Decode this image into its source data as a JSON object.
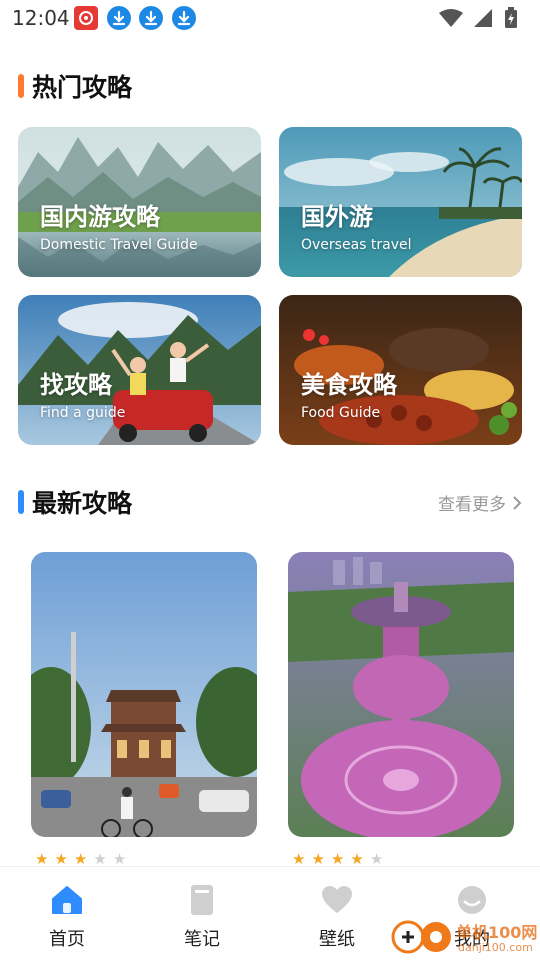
{
  "status_bar": {
    "time": "12:04",
    "notification_icons": [
      "app-red-icon",
      "download-icon",
      "download-icon",
      "download-icon"
    ],
    "right_icons": [
      "wifi-icon",
      "signal-icon",
      "battery-charging-icon"
    ]
  },
  "hot": {
    "title": "热门攻略",
    "accent": "#ff7a2f",
    "cards": [
      {
        "title": "国内游攻略",
        "subtitle": "Domestic Travel Guide"
      },
      {
        "title": "国外游",
        "subtitle": "Overseas travel"
      },
      {
        "title": "找攻略",
        "subtitle": "Find a guide"
      },
      {
        "title": "美食攻略",
        "subtitle": "Food Guide"
      }
    ]
  },
  "latest": {
    "title": "最新攻略",
    "accent": "#2f8cff",
    "more": "查看更多",
    "items": [
      {
        "rating": 3,
        "max": 5
      },
      {
        "rating": 4,
        "max": 5
      }
    ]
  },
  "nav": {
    "items": [
      {
        "label": "首页",
        "active": true
      },
      {
        "label": "笔记",
        "active": false
      },
      {
        "label": "壁纸",
        "active": false
      },
      {
        "label": "我的",
        "active": false
      }
    ],
    "active_color": "#2f8cff",
    "inactive_color": "#cfcfcf"
  },
  "watermark": {
    "text": "单机100网",
    "domain": "danji100.com"
  }
}
